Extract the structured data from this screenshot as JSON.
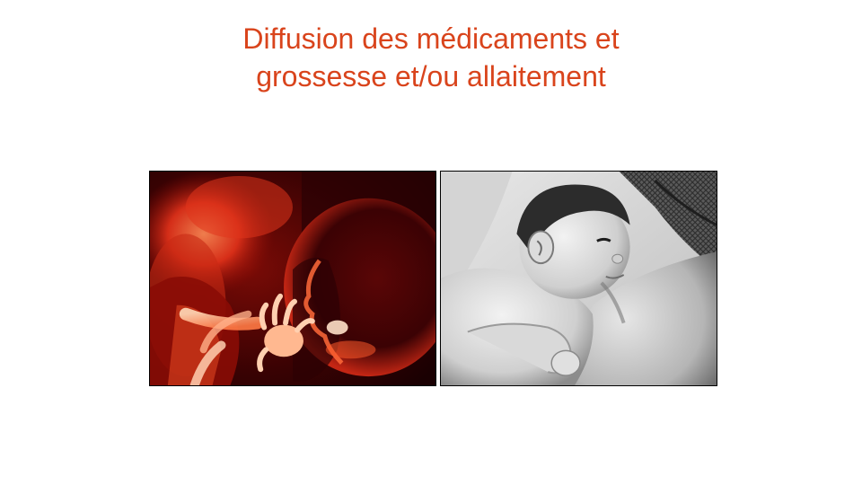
{
  "slide": {
    "title_line1": "Diffusion des médicaments et",
    "title_line2": "grossesse et/ou allaitement"
  },
  "colors": {
    "title": "#d9441c",
    "background": "#ffffff"
  },
  "images": [
    {
      "name": "fetus-photo",
      "tone": "red"
    },
    {
      "name": "breastfeeding-photo",
      "tone": "grayscale"
    }
  ]
}
